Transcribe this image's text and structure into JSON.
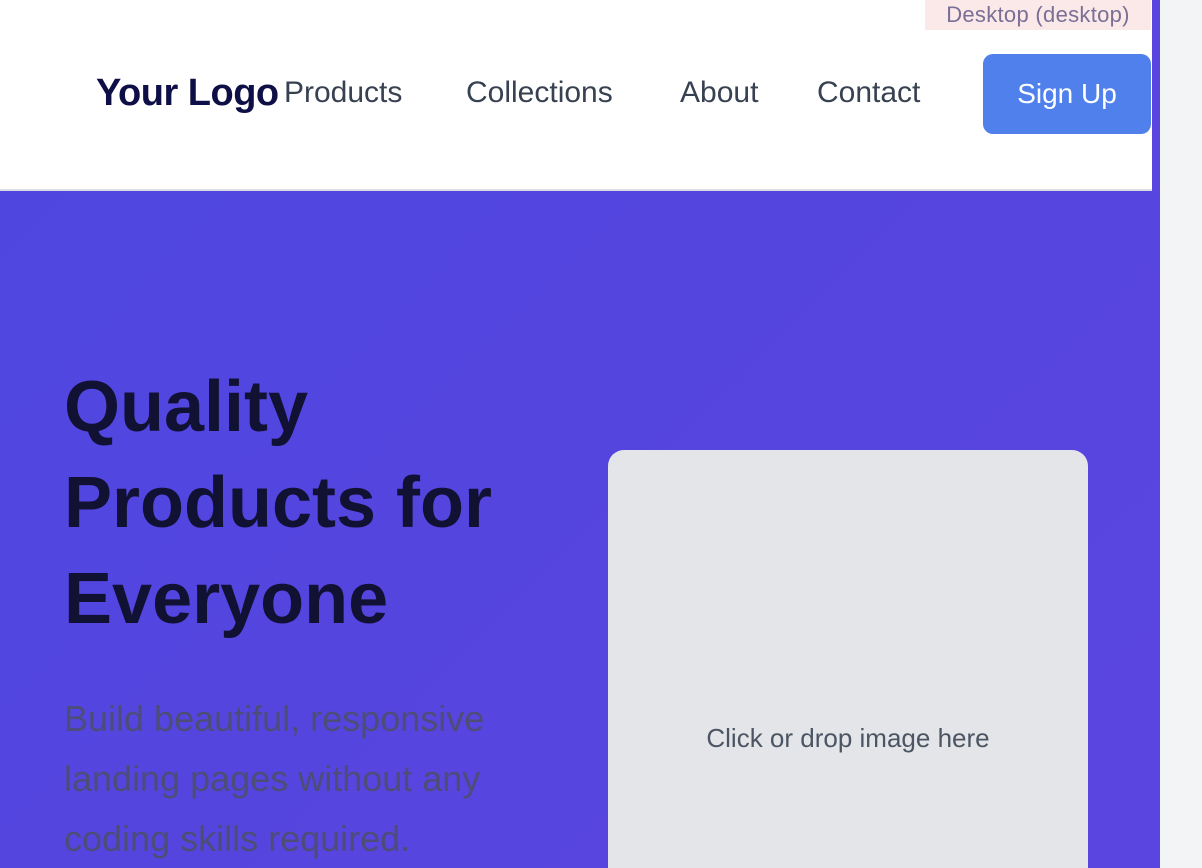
{
  "viewport_badge": "Desktop (desktop)",
  "header": {
    "logo": "Your Logo",
    "nav": [
      "Products",
      "Collections",
      "About",
      "Contact"
    ],
    "signup_label": "Sign Up"
  },
  "hero": {
    "title": "Quality Products for Everyone",
    "subtitle": "Build beautiful, responsive landing pages without any coding skills required.",
    "dropzone_label": "Click or drop image here"
  },
  "colors": {
    "hero_bg": "#5645df",
    "button": "#4f80ec",
    "logo": "#0f0f47",
    "dropzone": "#e4e5e9"
  }
}
